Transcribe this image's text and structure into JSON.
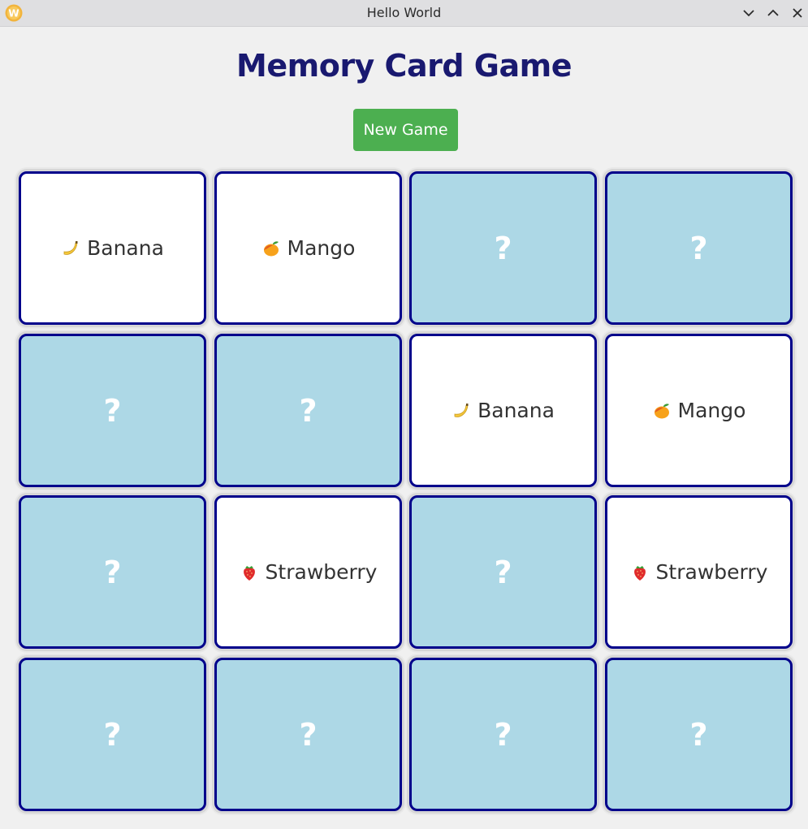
{
  "window": {
    "title": "Hello World"
  },
  "game": {
    "heading": "Memory Card Game",
    "new_game_label": "New Game"
  },
  "colors": {
    "heading": "#191970",
    "button_bg": "#4caf50",
    "card_hidden_bg": "#add8e6",
    "card_shown_bg": "#ffffff",
    "card_border": "#00008b"
  },
  "cards": [
    {
      "state": "shown",
      "label": "Banana",
      "icon": "banana-icon"
    },
    {
      "state": "shown",
      "label": "Mango",
      "icon": "mango-icon"
    },
    {
      "state": "hidden",
      "label": "?"
    },
    {
      "state": "hidden",
      "label": "?"
    },
    {
      "state": "hidden",
      "label": "?"
    },
    {
      "state": "hidden",
      "label": "?"
    },
    {
      "state": "shown",
      "label": "Banana",
      "icon": "banana-icon"
    },
    {
      "state": "shown",
      "label": "Mango",
      "icon": "mango-icon"
    },
    {
      "state": "hidden",
      "label": "?"
    },
    {
      "state": "shown",
      "label": "Strawberry",
      "icon": "strawberry-icon"
    },
    {
      "state": "hidden",
      "label": "?"
    },
    {
      "state": "shown",
      "label": "Strawberry",
      "icon": "strawberry-icon"
    },
    {
      "state": "hidden",
      "label": "?"
    },
    {
      "state": "hidden",
      "label": "?"
    },
    {
      "state": "hidden",
      "label": "?"
    },
    {
      "state": "hidden",
      "label": "?"
    }
  ]
}
